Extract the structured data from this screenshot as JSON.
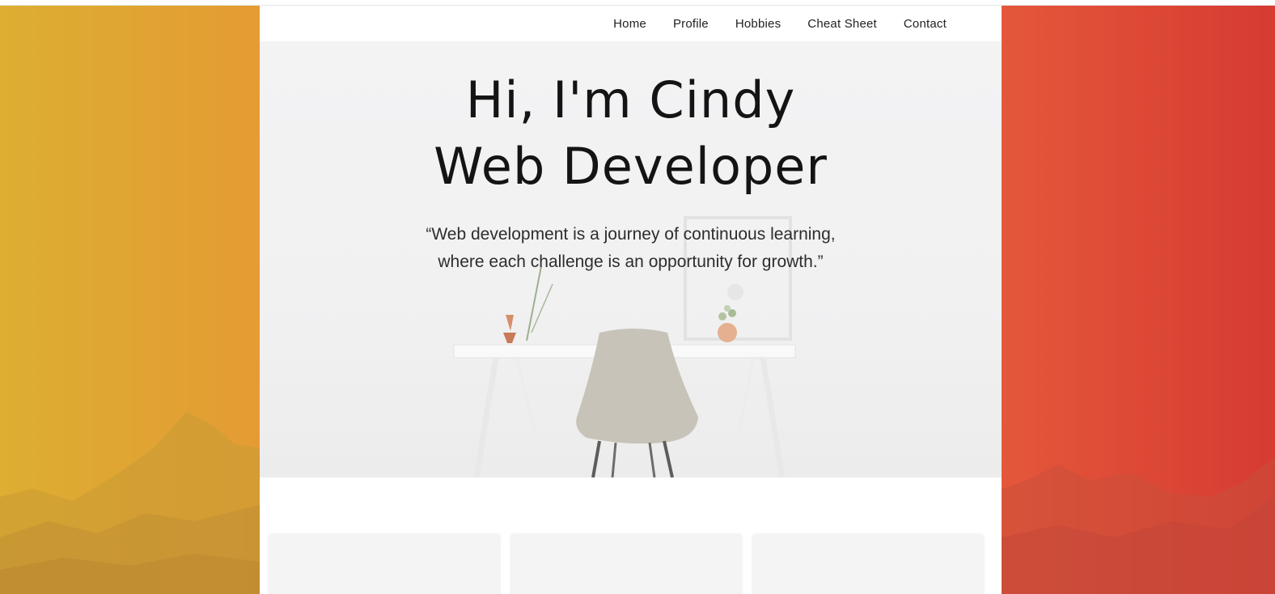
{
  "nav": {
    "items": [
      {
        "label": "Home"
      },
      {
        "label": "Profile"
      },
      {
        "label": "Hobbies"
      },
      {
        "label": "Cheat Sheet"
      },
      {
        "label": "Contact"
      }
    ]
  },
  "hero": {
    "title_line1": "Hi, I'm Cindy",
    "title_line2": "Web Developer",
    "quote_line1": "“Web development is a journey of continuous learning,",
    "quote_line2": "where each challenge is an opportunity for growth.”"
  },
  "cards": {
    "count_visible": 3
  },
  "colors": {
    "gradient_left": "#dcae32",
    "gradient_mid": "#e47a34",
    "gradient_right": "#d63b32",
    "hero_bg": "#f2f2f3",
    "card_bg": "#f4f4f4",
    "text": "#141414"
  }
}
